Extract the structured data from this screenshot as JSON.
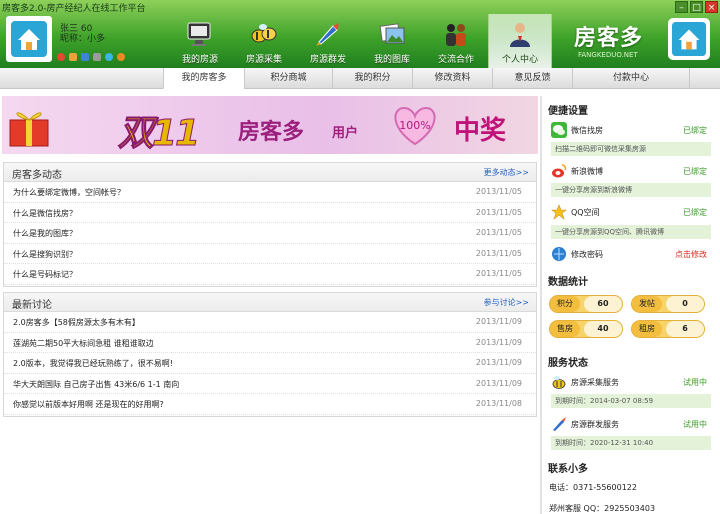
{
  "window": {
    "title": "房客多2.0-房产经纪人在线工作平台",
    "min": "–",
    "max": "□",
    "close": "×"
  },
  "user": {
    "name_label": "张三 60",
    "nickname": "昵称：小多"
  },
  "nav": {
    "items": [
      {
        "label": "我的房源",
        "icon": "house-monitor-icon"
      },
      {
        "label": "房源采集",
        "icon": "collect-bees-icon"
      },
      {
        "label": "房源群发",
        "icon": "rocket-icon"
      },
      {
        "label": "我的图库",
        "icon": "photo-gallery-icon"
      },
      {
        "label": "交流合作",
        "icon": "handshake-icon"
      },
      {
        "label": "个人中心",
        "icon": "person-icon"
      }
    ],
    "active_index": 5
  },
  "logo": {
    "text": "房客多",
    "sub": "FANGKEDUO.NET"
  },
  "subtabs": {
    "items": [
      "我的房客多",
      "积分商城",
      "我的积分",
      "修改资料",
      "意见反馈",
      "付款中心"
    ],
    "active_index": 0
  },
  "banner": {
    "t1": "双11",
    "t2": "房客多",
    "t3": "用户",
    "heart": "100%",
    "t4": "中奖"
  },
  "news": {
    "title": "房客多动态",
    "more": "更多动态>>",
    "rows": [
      {
        "text": "为什么要绑定微博，空间帐号？",
        "date": "2013/11/05"
      },
      {
        "text": "什么是微信找房？",
        "date": "2013/11/05"
      },
      {
        "text": "什么是我的图库？",
        "date": "2013/11/05"
      },
      {
        "text": "什么是搜狗识别？",
        "date": "2013/11/05"
      },
      {
        "text": "什么是号码标记？",
        "date": "2013/11/05"
      }
    ]
  },
  "discuss": {
    "title": "最新讨论",
    "more": "参与讨论>>",
    "rows": [
      {
        "text": "2.0房客多【58假房源太多有木有】",
        "date": "2013/11/09"
      },
      {
        "text": "莲湖苑二期50平大标间急租 谁租谁取边",
        "date": "2013/11/09"
      },
      {
        "text": "2.0版本，我觉得我已经玩熟练了，很不易啊!",
        "date": "2013/11/09"
      },
      {
        "text": "华大天朗国际 自己房子出售 43米6/6 1-1 南向",
        "date": "2013/11/09"
      },
      {
        "text": "你感觉以前版本好用啊 还是现在的好用啊?",
        "date": "2013/11/08"
      }
    ]
  },
  "shortcuts": {
    "title": "便捷设置",
    "wechat": {
      "label": "微信找房",
      "status": "已绑定",
      "desc": "扫描二维码即可微信采集房源"
    },
    "weibo": {
      "label": "新浪微博",
      "status": "已绑定",
      "desc": "一键分享房源到新浪微博"
    },
    "qzone": {
      "label": "QQ空间",
      "status": "已绑定",
      "desc": "一键分享房源到QQ空间、腾讯微博"
    },
    "pwd": {
      "label": "修改密码",
      "status": "点击修改"
    }
  },
  "stats": {
    "title": "数据统计",
    "items": [
      {
        "key": "积分",
        "value": "60"
      },
      {
        "key": "发帖",
        "value": "0"
      },
      {
        "key": "售房",
        "value": "40"
      },
      {
        "key": "租房",
        "value": "6"
      }
    ]
  },
  "services": {
    "title": "服务状态",
    "collect": {
      "label": "房源采集服务",
      "status": "试用中",
      "expire": "到期时间：2014-03-07 08:59"
    },
    "publish": {
      "label": "房源群发服务",
      "status": "试用中",
      "expire": "到期时间：2020-12-31 10:40"
    }
  },
  "contact": {
    "title": "联系小多",
    "phone": "电话：0371-55600122",
    "qq": "郑州客服 QQ：2925503403"
  },
  "colors": {
    "green": "#3fa32a",
    "accent": "#f3be3e",
    "link": "#1f5fbf"
  }
}
